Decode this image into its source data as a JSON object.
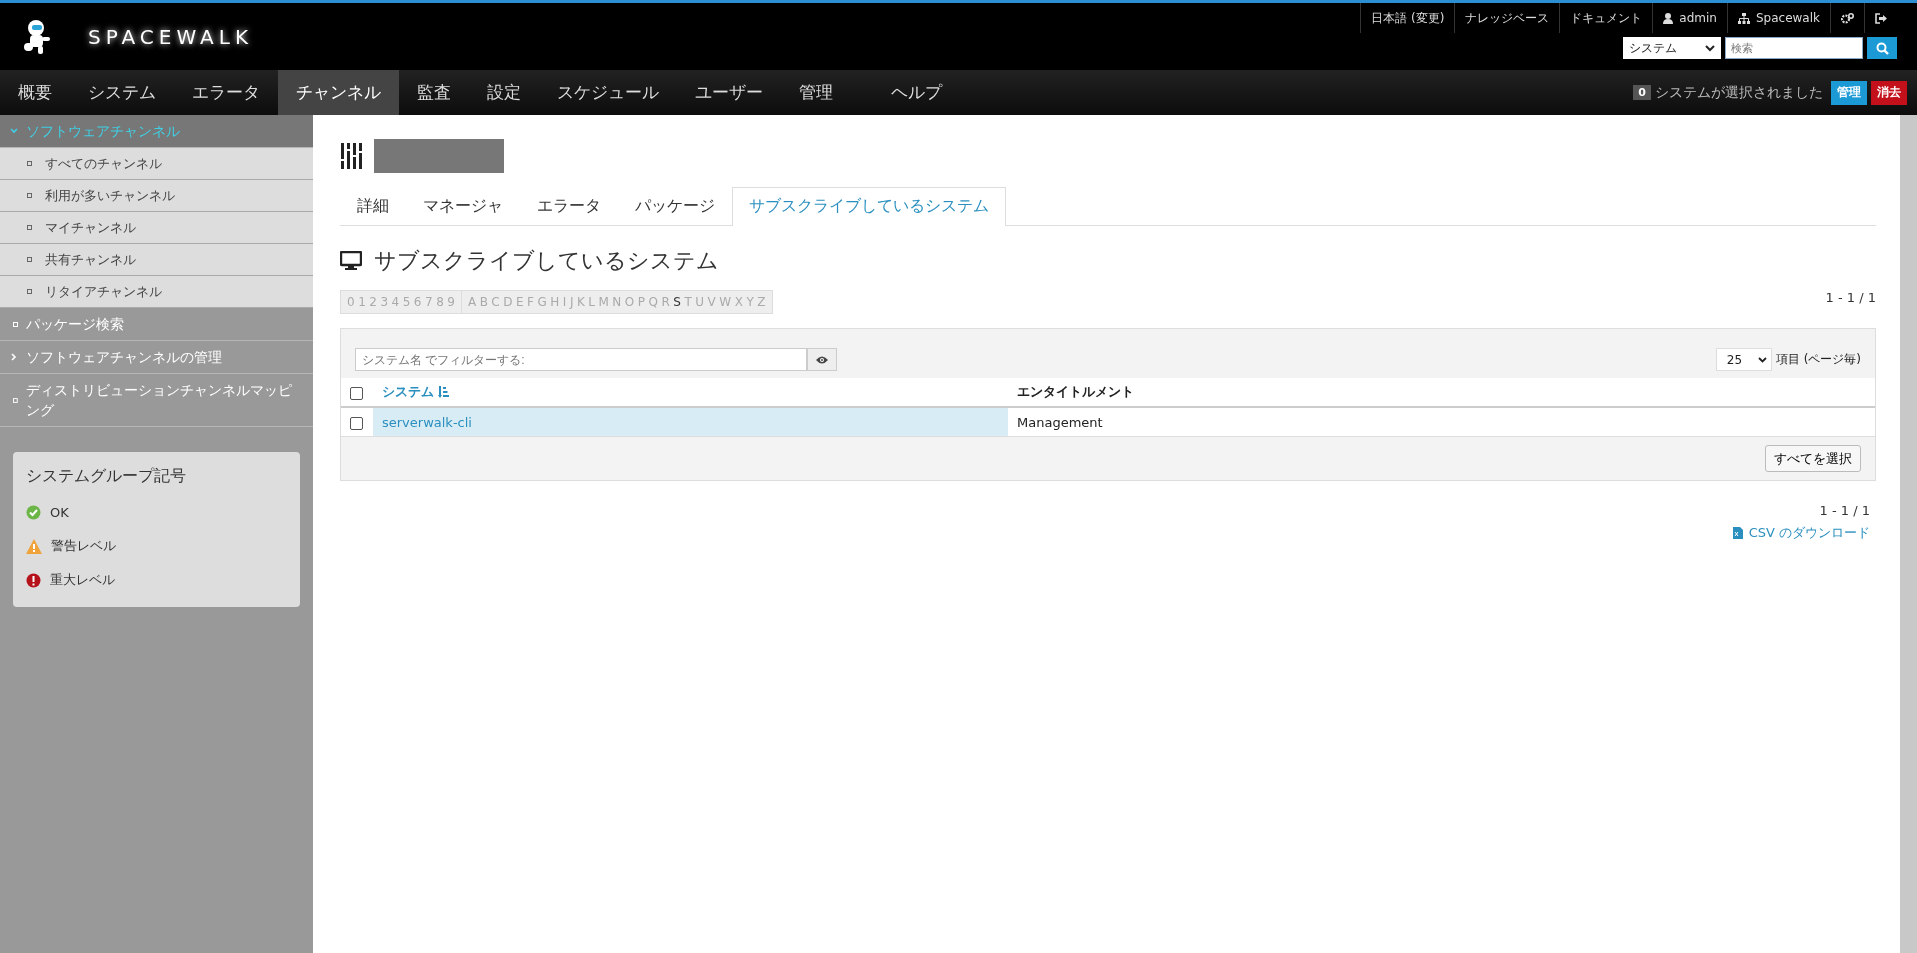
{
  "header": {
    "logo": "SPACEWALK",
    "top_links": [
      {
        "kind": "text",
        "label": "日本語 (変更)"
      },
      {
        "kind": "text",
        "label": "ナレッジベース"
      },
      {
        "kind": "text",
        "label": "ドキュメント"
      },
      {
        "kind": "user",
        "label": "admin"
      },
      {
        "kind": "org",
        "label": "Spacewalk"
      },
      {
        "kind": "gears"
      },
      {
        "kind": "signout"
      }
    ],
    "search_scope": "システム",
    "search": {
      "placeholder": "検索"
    }
  },
  "nav": [
    {
      "label": "概要",
      "selected": false
    },
    {
      "label": "システム",
      "selected": false
    },
    {
      "label": "エラータ",
      "selected": false
    },
    {
      "label": "チャンネル",
      "selected": true
    },
    {
      "label": "監査",
      "selected": false
    },
    {
      "label": "設定",
      "selected": false
    },
    {
      "label": "スケジュール",
      "selected": false
    },
    {
      "label": "ユーザー",
      "selected": false
    },
    {
      "label": "管理",
      "selected": false
    },
    {
      "label": "ヘルプ",
      "selected": false
    }
  ],
  "ssm": {
    "count": "0",
    "text": "システムが選択されました",
    "manage": "管理",
    "clear": "消去"
  },
  "sidebar": {
    "items": [
      {
        "label": "ソフトウェアチャンネル",
        "kind": "group",
        "expanded": true,
        "selected": true,
        "children": [
          {
            "label": "すべてのチャンネル",
            "selected": false
          },
          {
            "label": "利用が多いチャンネル",
            "selected": false
          },
          {
            "label": "マイチャンネル",
            "selected": false
          },
          {
            "label": "共有チャンネル",
            "selected": false
          },
          {
            "label": "リタイアチャンネル",
            "selected": false
          }
        ]
      },
      {
        "label": "パッケージ検索",
        "kind": "link",
        "selected": false
      },
      {
        "label": "ソフトウェアチャンネルの管理",
        "kind": "group",
        "expanded": false,
        "selected": false
      },
      {
        "label": "ディストリビューションチャンネルマッピング",
        "kind": "link",
        "selected": false
      }
    ],
    "legend": {
      "title": "システムグループ記号",
      "items": [
        {
          "kind": "ok",
          "label": "OK"
        },
        {
          "kind": "warning",
          "label": "警告レベル"
        },
        {
          "kind": "critical",
          "label": "重大レベル"
        }
      ]
    }
  },
  "tabs": [
    {
      "label": "詳細",
      "selected": false
    },
    {
      "label": "マネージャ",
      "selected": false
    },
    {
      "label": "エラータ",
      "selected": false
    },
    {
      "label": "パッケージ",
      "selected": false
    },
    {
      "label": "サブスクライブしているシステム",
      "selected": true
    }
  ],
  "section_title": "サブスクライブしているシステム",
  "alphabet": [
    [
      {
        "label": "0",
        "enabled": false
      },
      {
        "label": "1",
        "enabled": false
      },
      {
        "label": "2",
        "enabled": false
      },
      {
        "label": "3",
        "enabled": false
      },
      {
        "label": "4",
        "enabled": false
      },
      {
        "label": "5",
        "enabled": false
      },
      {
        "label": "6",
        "enabled": false
      },
      {
        "label": "7",
        "enabled": false
      },
      {
        "label": "8",
        "enabled": false
      },
      {
        "label": "9",
        "enabled": false
      }
    ],
    [
      {
        "label": "A",
        "enabled": false
      },
      {
        "label": "B",
        "enabled": false
      },
      {
        "label": "C",
        "enabled": false
      },
      {
        "label": "D",
        "enabled": false
      },
      {
        "label": "E",
        "enabled": false
      },
      {
        "label": "F",
        "enabled": false
      },
      {
        "label": "G",
        "enabled": false
      },
      {
        "label": "H",
        "enabled": false
      },
      {
        "label": "I",
        "enabled": false
      },
      {
        "label": "J",
        "enabled": false
      },
      {
        "label": "K",
        "enabled": false
      },
      {
        "label": "L",
        "enabled": false
      },
      {
        "label": "M",
        "enabled": false
      },
      {
        "label": "N",
        "enabled": false
      },
      {
        "label": "O",
        "enabled": false
      },
      {
        "label": "P",
        "enabled": false
      },
      {
        "label": "Q",
        "enabled": false
      },
      {
        "label": "R",
        "enabled": false
      },
      {
        "label": "S",
        "enabled": true
      },
      {
        "label": "T",
        "enabled": false
      },
      {
        "label": "U",
        "enabled": false
      },
      {
        "label": "V",
        "enabled": false
      },
      {
        "label": "W",
        "enabled": false
      },
      {
        "label": "X",
        "enabled": false
      },
      {
        "label": "Y",
        "enabled": false
      },
      {
        "label": "Z",
        "enabled": false
      }
    ]
  ],
  "pagination_top": "1 - 1 / 1",
  "filter": {
    "placeholder": "システム名 でフィルターする:"
  },
  "page_size": "25",
  "page_size_label": "項目 (ページ毎)",
  "table": {
    "all_checked": false,
    "columns": [
      "システム",
      "エンタイトルメント"
    ],
    "rows": [
      {
        "checked": false,
        "system": "serverwalk-cli",
        "entitlement": "Management"
      }
    ]
  },
  "select_all": "すべてを選択",
  "pagination_bottom": "1 - 1 / 1",
  "csv_link": "CSV のダウンロード"
}
